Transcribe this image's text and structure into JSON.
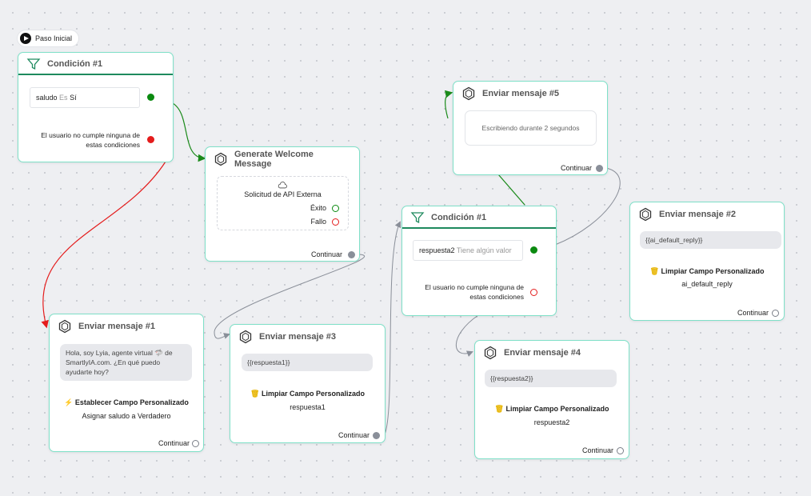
{
  "start": {
    "label": "Paso Inicial"
  },
  "colors": {
    "border": "#7fe0c8",
    "success": "#0b8a10",
    "fail": "#e41c1c",
    "neutral": "#8a8f99"
  },
  "cond1": {
    "title": "Condición #1",
    "field": "saludo",
    "operator": "Es",
    "value": "Sí",
    "else_text": "El usuario no cumple ninguna de estas condiciones"
  },
  "welcome": {
    "title": "Generate Welcome Message",
    "api_label": "Solicitud de API Externa",
    "success_label": "Éxito",
    "fail_label": "Fallo",
    "continue": "Continuar"
  },
  "msg1": {
    "title": "Enviar mensaje #1",
    "text": "Hola, soy Lyia, agente virtual 🦈 de SmartlyIA.com. ¿En qué puedo ayudarte hoy?",
    "action_title": "Establecer Campo Personalizado",
    "action_detail": "Asignar saludo a Verdadero",
    "continue": "Continuar"
  },
  "msg3": {
    "title": "Enviar mensaje #3",
    "text": "{{respuesta1}}",
    "action_title": "Limpiar Campo Personalizado",
    "action_detail": "respuesta1",
    "continue": "Continuar"
  },
  "cond2": {
    "title": "Condición #1",
    "field": "respuesta2",
    "operator": "Tiene algún valor",
    "else_text": "El usuario no cumple ninguna de estas condiciones"
  },
  "msg5": {
    "title": "Enviar mensaje #5",
    "typing": "Escribiendo durante 2 segundos",
    "continue": "Continuar"
  },
  "msg2": {
    "title": "Enviar mensaje #2",
    "text": "{{ai_default_reply}}",
    "action_title": "Limpiar Campo Personalizado",
    "action_detail": "ai_default_reply",
    "continue": "Continuar"
  },
  "msg4": {
    "title": "Enviar mensaje #4",
    "text": "{{respuesta2}}",
    "action_title": "Limpiar Campo Personalizado",
    "action_detail": "respuesta2",
    "continue": "Continuar"
  }
}
